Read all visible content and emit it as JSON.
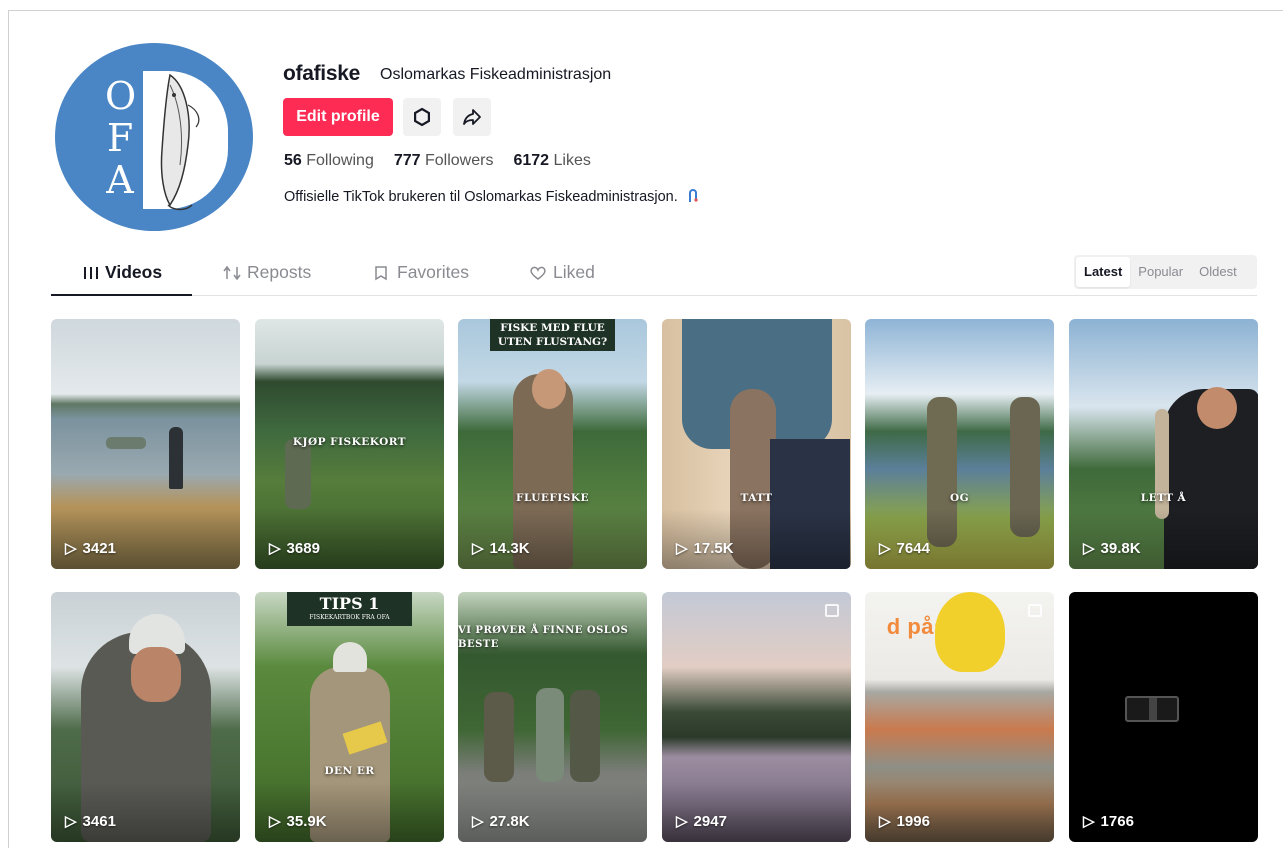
{
  "profile": {
    "username": "ofafiske",
    "nickname": "Oslomarkas Fiskeadministrasjon",
    "avatar_letters": [
      "O",
      "F",
      "A"
    ],
    "edit_label": "Edit profile",
    "settings_icon": "gear-icon",
    "share_icon": "share-icon",
    "stats": {
      "following_count": "56",
      "following_label": "Following",
      "followers_count": "777",
      "followers_label": "Followers",
      "likes_count": "6172",
      "likes_label": "Likes"
    },
    "bio": "Offisielle TikTok brukeren til Oslomarkas Fiskeadministrasjon."
  },
  "tabs": [
    {
      "label": "Videos",
      "icon": "grid-icon",
      "active": true
    },
    {
      "label": "Reposts",
      "icon": "repost-icon",
      "active": false
    },
    {
      "label": "Favorites",
      "icon": "bookmark-icon",
      "active": false
    },
    {
      "label": "Liked",
      "icon": "heart-icon",
      "active": false
    }
  ],
  "sort": {
    "options": [
      "Latest",
      "Popular",
      "Oldest"
    ],
    "selected": "Latest"
  },
  "videos": [
    {
      "views": "3421",
      "overlay": ""
    },
    {
      "views": "3689",
      "overlay": "KJØP        FISKEKORT"
    },
    {
      "views": "14.3K",
      "top_caption": "FISKE MED FLUE UTEN FLUSTANG?",
      "overlay": "FLUEFISKE"
    },
    {
      "views": "17.5K",
      "overlay": "TATT"
    },
    {
      "views": "7644",
      "overlay": "OG"
    },
    {
      "views": "39.8K",
      "overlay": "LETT Å"
    },
    {
      "views": "3461",
      "overlay": ""
    },
    {
      "views": "35.9K",
      "top_caption": "TIPS 1",
      "top_sub": "FISKEKARTBOK FRA OFA",
      "overlay": "DEN ER"
    },
    {
      "views": "27.8K",
      "overlay": "VI PRØVER Å FINNE OSLOS BESTE"
    },
    {
      "views": "2947",
      "overlay": "",
      "photo": true
    },
    {
      "views": "1996",
      "overlay": "d påske",
      "photo": true
    },
    {
      "views": "1766",
      "overlay": ""
    }
  ]
}
